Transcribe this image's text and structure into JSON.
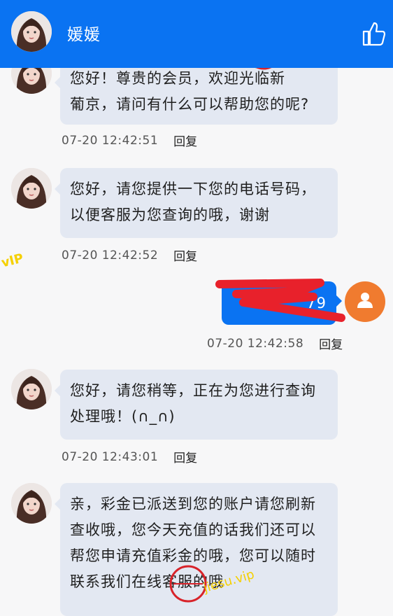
{
  "header": {
    "title": "媛媛"
  },
  "messages": [
    {
      "side": "left",
      "lines": [
        "您好！尊贵的会员，欢迎光临新",
        "葡京，请问有什么可以帮助您的呢?"
      ],
      "time": "07-20 12:42:51",
      "reply": "回复"
    },
    {
      "side": "left",
      "lines": [
        "您好，请您提供一下您的电话号码，",
        "以便客服为您查询的哦，谢谢"
      ],
      "time": "07-20 12:42:52",
      "reply": "回复"
    },
    {
      "side": "right",
      "lines": [
        "79"
      ],
      "time": "07-20 12:42:58",
      "reply": "回复"
    },
    {
      "side": "left",
      "lines": [
        "您好，请您稍等，正在为您进行查询",
        "处理哦！(∩_∩)"
      ],
      "time": "07-20 12:43:01",
      "reply": "回复"
    },
    {
      "side": "left",
      "lines": [
        "亲，彩金已派送到您的账户请您刷新",
        "查收哦，您今天充值的话我们还可以",
        "帮您申请充值彩金的哦，您可以随时",
        "联系我们在线客服的哦"
      ],
      "time": "",
      "reply": ""
    }
  ],
  "watermark": {
    "text": "jiesu.vip",
    "text2": "vIP"
  },
  "colors": {
    "header": "#0a73f2",
    "bubble_left": "#e3e8f2",
    "bubble_right": "#0a73f2",
    "user_avatar": "#f07b2f",
    "redaction": "#e8212b"
  },
  "icons": {
    "like": "thumbs-up-icon",
    "user": "user-icon"
  }
}
